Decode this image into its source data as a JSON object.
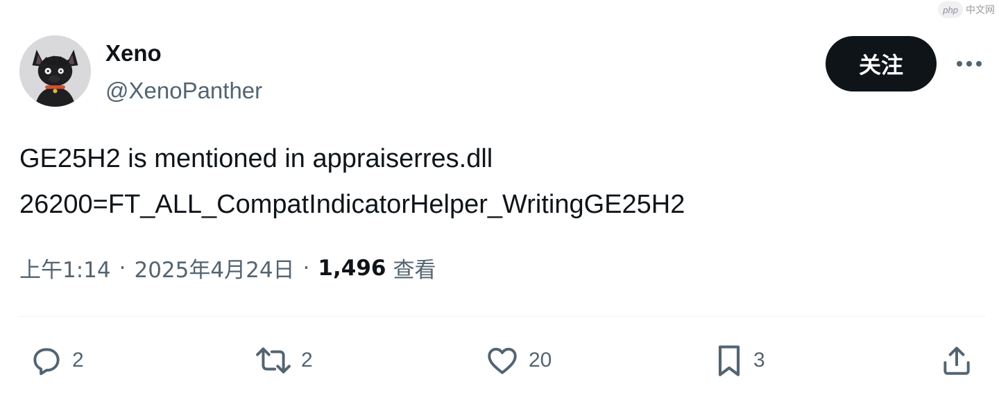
{
  "watermark": {
    "logo": "php",
    "text": "中文网"
  },
  "author": {
    "name": "Xeno",
    "handle": "@XenoPanther",
    "avatar_icon": "black-cat-avatar"
  },
  "header": {
    "follow_label": "关注",
    "more_icon": "more-horizontal-icon"
  },
  "tweet": {
    "lines": [
      "GE25H2 is mentioned in appraiserres.dll",
      "26200=FT_ALL_CompatIndicatorHelper_WritingGE25H2"
    ]
  },
  "meta": {
    "time": "上午1:14",
    "separator": "·",
    "date": "2025年4月24日",
    "views_count": "1,496",
    "views_label": "查看"
  },
  "actions": {
    "reply": {
      "icon": "reply-bubble-icon",
      "count": "2"
    },
    "retweet": {
      "icon": "retweet-icon",
      "count": "2"
    },
    "like": {
      "icon": "heart-icon",
      "count": "20"
    },
    "bookmark": {
      "icon": "bookmark-icon",
      "count": "3"
    },
    "share": {
      "icon": "share-upload-icon"
    }
  },
  "colors": {
    "text_primary": "#0f1419",
    "text_secondary": "#536471",
    "button_bg": "#0f1419",
    "button_text": "#ffffff",
    "divider": "#eff3f4"
  }
}
